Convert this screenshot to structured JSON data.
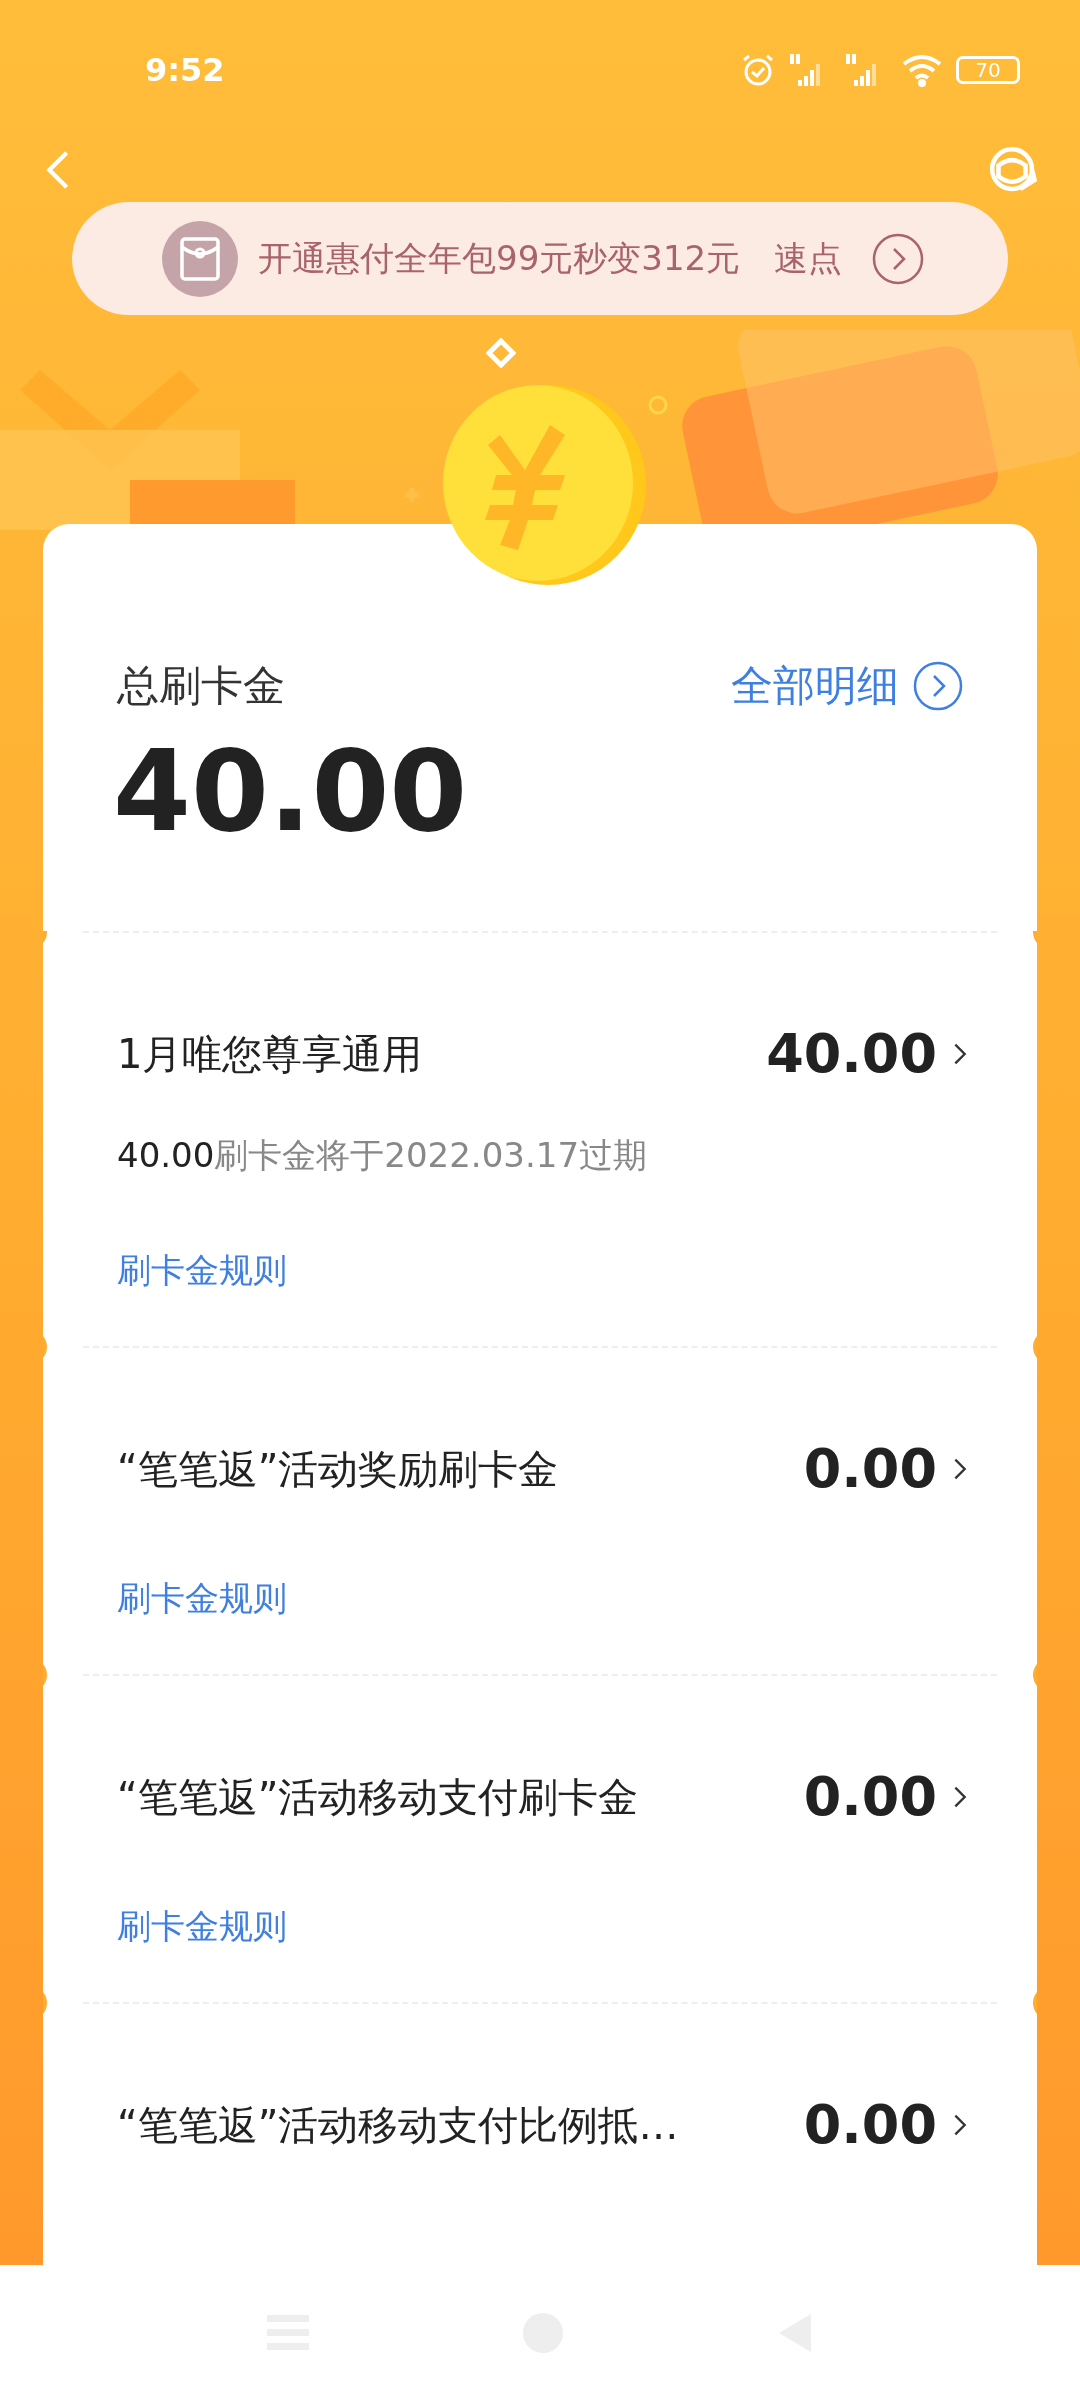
{
  "status_bar": {
    "time": "9:52",
    "battery": "70"
  },
  "banner": {
    "text": "开通惠付全年包99元秒变312元",
    "action": "速点"
  },
  "summary": {
    "label": "总刷卡金",
    "link": "全部明细",
    "amount": "40.00"
  },
  "items": [
    {
      "title": "1月唯您尊享通用",
      "amount": "40.00",
      "note_amount": "40.00",
      "note": "刷卡金将于2022.03.17过期",
      "rule": "刷卡金规则"
    },
    {
      "title": "“笔笔返”活动奖励刷卡金",
      "amount": "0.00",
      "rule": "刷卡金规则"
    },
    {
      "title": "“笔笔返”活动移动支付刷卡金",
      "amount": "0.00",
      "rule": "刷卡金规则"
    },
    {
      "title": "“笔笔返”活动移动支付比例抵…",
      "amount": "0.00"
    }
  ]
}
